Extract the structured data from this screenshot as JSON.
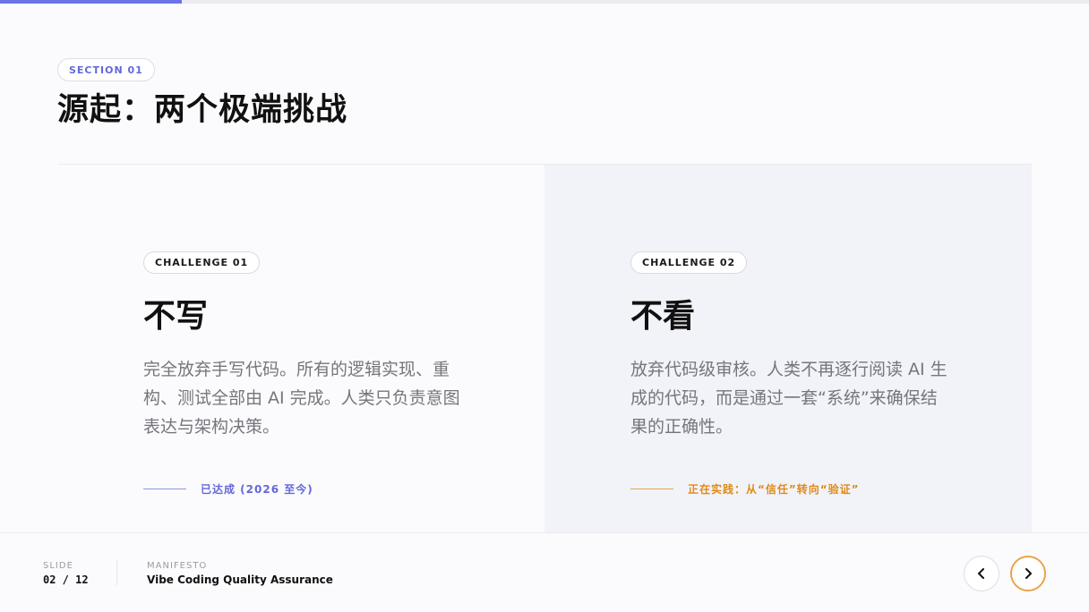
{
  "progress": {
    "fraction": 0.1667,
    "color": "#6c72e8"
  },
  "header": {
    "section_tag": "SECTION 01",
    "title": "源起：两个极端挑战"
  },
  "cards": [
    {
      "tag": "CHALLENGE 01",
      "title": "不写",
      "description": "完全放弃手写代码。所有的逻辑实现、重构、测试全部由 AI 完成。人类只负责意图表达与架构决策。",
      "status": "已达成 (2026 至今)",
      "accent": "#6468d8"
    },
    {
      "tag": "CHALLENGE 02",
      "title": "不看",
      "description": "放弃代码级审核。人类不再逐行阅读 AI 生成的代码，而是通过一套“系统”来确保结果的正确性。",
      "status": "正在实践：从“信任”转向“验证”",
      "accent": "#e08a17"
    }
  ],
  "footer": {
    "slide_label": "SLIDE",
    "slide_count": "02 / 12",
    "manifesto_label": "MANIFESTO",
    "deck_title": "Vibe Coding Quality Assurance",
    "prev_icon": "chevron-left-icon",
    "next_icon": "chevron-right-icon"
  }
}
